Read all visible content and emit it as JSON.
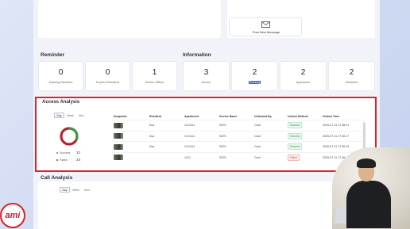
{
  "post_new_message": {
    "label": "Post New Message",
    "icon": "envelope-icon"
  },
  "reminder": {
    "title": "Reminder",
    "stats": [
      {
        "value": "0",
        "label": "Expiring Resident"
      },
      {
        "value": "0",
        "label": "Expired Resident"
      },
      {
        "value": "1",
        "label": "Device Offline"
      }
    ]
  },
  "information": {
    "title": "Information",
    "stats": [
      {
        "value": "3",
        "label": "Device"
      },
      {
        "value": "2",
        "label": "Building"
      },
      {
        "value": "2",
        "label": "Apartment"
      },
      {
        "value": "2",
        "label": "Resident"
      }
    ]
  },
  "access_analysis": {
    "title": "Access Analysis",
    "tabs": [
      "Day",
      "Week",
      "Mon"
    ],
    "active_tab": "Day",
    "legend": [
      {
        "label": "Success",
        "value": "12",
        "color": "#3c9a4b"
      },
      {
        "label": "Failed",
        "value": "24",
        "color": "#b3262e"
      }
    ],
    "columns": [
      "Snapshot",
      "Resident",
      "Apartment",
      "Device Name",
      "Unlocked By",
      "Unlock Method",
      "Unlock Time"
    ],
    "rows": [
      {
        "resident": "Ava",
        "apartment": "1/1/1111",
        "device": "S675",
        "by": "Card",
        "method": "Success",
        "time": "2025-07-11 17:38:21"
      },
      {
        "resident": "Ava",
        "apartment": "1/1/1111",
        "device": "S675",
        "by": "Card",
        "method": "Success",
        "time": "2025-07-11 17:36:17"
      },
      {
        "resident": "Ava",
        "apartment": "1/1/1111",
        "device": "S675",
        "by": "Card",
        "method": "Success",
        "time": "2025-07-11 17:36:13"
      },
      {
        "resident": "",
        "apartment": "1/1/1",
        "device": "S675",
        "by": "Card",
        "method": "Failed",
        "time": "2025-07-11 17:36:10"
      }
    ]
  },
  "call_analysis": {
    "title": "Call Analysis",
    "tabs": [
      "Day",
      "Week",
      "Mon"
    ],
    "active_tab": "Day"
  },
  "logo": {
    "text": "ami"
  }
}
